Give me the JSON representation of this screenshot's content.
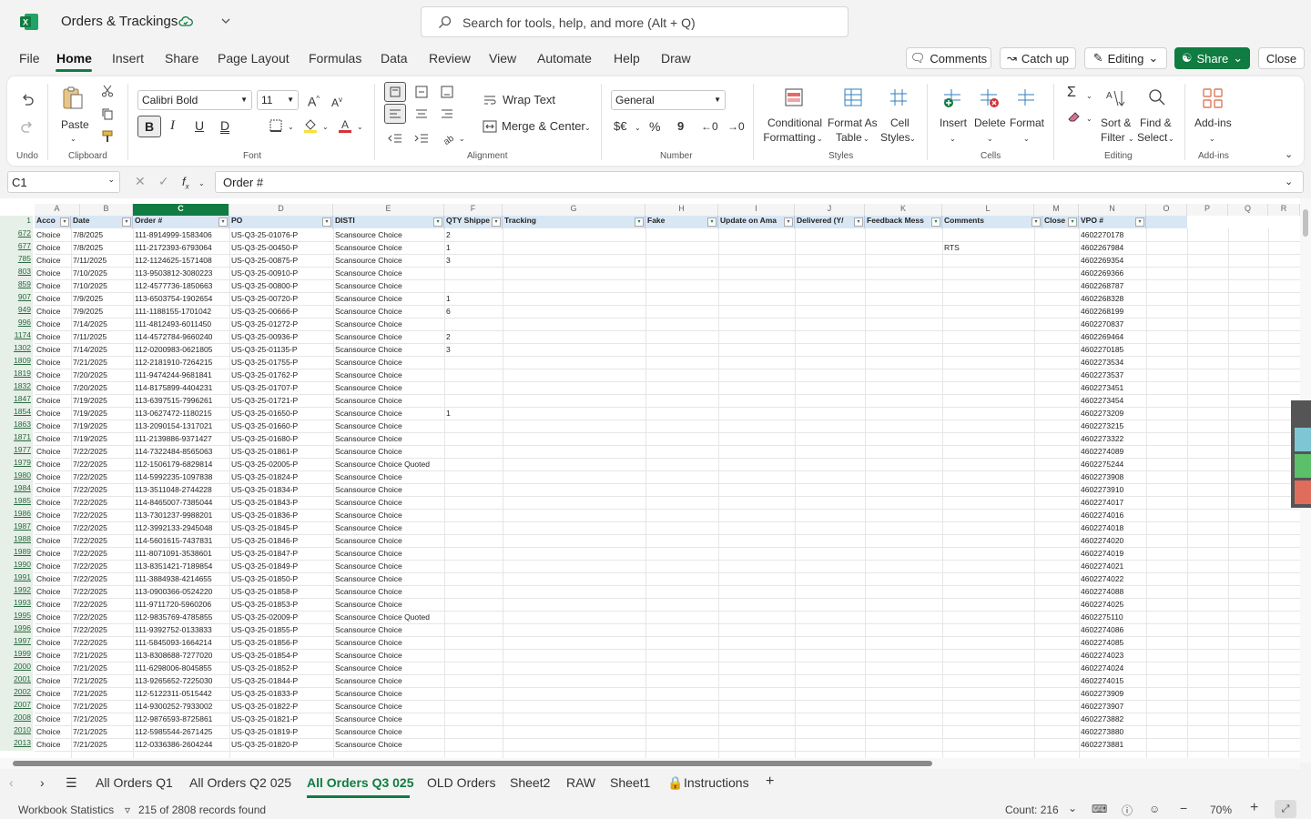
{
  "titlebar": {
    "doc_title": "Orders & Trackings",
    "search_placeholder": "Search for tools, help, and more (Alt + Q)"
  },
  "menu": [
    "File",
    "Home",
    "Insert",
    "Share",
    "Page Layout",
    "Formulas",
    "Data",
    "Review",
    "View",
    "Automate",
    "Help",
    "Draw"
  ],
  "top_buttons": {
    "comments": "Comments",
    "catch_up": "Catch up",
    "editing": "Editing",
    "share": "Share",
    "close": "Close"
  },
  "ribbon": {
    "undo": {
      "label": "Undo"
    },
    "clipboard": {
      "paste": "Paste",
      "label": "Clipboard"
    },
    "font": {
      "name": "Calibri Bold",
      "size": "11",
      "label": "Font"
    },
    "alignment": {
      "wrap": "Wrap Text",
      "merge": "Merge & Center",
      "label": "Alignment"
    },
    "number": {
      "format": "General",
      "label": "Number"
    },
    "styles": {
      "cond_a": "Conditional",
      "cond_b": "Formatting",
      "fat_a": "Format As",
      "fat_b": "Table",
      "cs_a": "Cell",
      "cs_b": "Styles",
      "label": "Styles"
    },
    "cells": {
      "insert": "Insert",
      "delete": "Delete",
      "format": "Format",
      "label": "Cells"
    },
    "editing": {
      "sort_a": "Sort &",
      "sort_b": "Filter",
      "find_a": "Find &",
      "find_b": "Select",
      "label": "Editing"
    },
    "addins": {
      "addins": "Add-ins",
      "label": "Add-ins"
    }
  },
  "formula": {
    "namebox": "C1",
    "content": "Order #"
  },
  "columns": [
    "A",
    "B",
    "C",
    "D",
    "E",
    "F",
    "G",
    "H",
    "I",
    "J",
    "K",
    "L",
    "M",
    "N",
    "O",
    "P",
    "Q",
    "R"
  ],
  "headers": [
    "Acco",
    "Date",
    "Order #",
    "PO",
    "DISTI",
    "QTY Shippe",
    "Tracking",
    "Fake",
    "Update on Ama",
    "Delivered (Y/",
    "Feedback Mess",
    "Comments",
    "Close",
    "VPO #"
  ],
  "rows": [
    [
      "672",
      "Choice",
      "7/8/2025",
      "111-8914999-1583406",
      "US-Q3-25-01076-P",
      "Scansource Choice",
      "2",
      "",
      "4602270178"
    ],
    [
      "677",
      "Choice",
      "7/8/2025",
      "111-2172393-6793064",
      "US-Q3-25-00450-P",
      "Scansource Choice",
      "1",
      "RTS",
      "4602267984"
    ],
    [
      "785",
      "Choice",
      "7/11/2025",
      "112-1124625-1571408",
      "US-Q3-25-00875-P",
      "Scansource Choice",
      "3",
      "",
      "4602269354"
    ],
    [
      "803",
      "Choice",
      "7/10/2025",
      "113-9503812-3080223",
      "US-Q3-25-00910-P",
      "Scansource Choice",
      "",
      "",
      "4602269366"
    ],
    [
      "859",
      "Choice",
      "7/10/2025",
      "112-4577736-1850663",
      "US-Q3-25-00800-P",
      "Scansource Choice",
      "",
      "",
      "4602268787"
    ],
    [
      "907",
      "Choice",
      "7/9/2025",
      "113-6503754-1902654",
      "US-Q3-25-00720-P",
      "Scansource Choice",
      "1",
      "",
      "4602268328"
    ],
    [
      "949",
      "Choice",
      "7/9/2025",
      "111-1188155-1701042",
      "US-Q3-25-00666-P",
      "Scansource Choice",
      "6",
      "",
      "4602268199"
    ],
    [
      "996",
      "Choice",
      "7/14/2025",
      "111-4812493-6011450",
      "US-Q3-25-01272-P",
      "Scansource Choice",
      "",
      "",
      "4602270837"
    ],
    [
      "1174",
      "Choice",
      "7/11/2025",
      "114-4572784-9660240",
      "US-Q3-25-00936-P",
      "Scansource Choice",
      "2",
      "",
      "4602269464"
    ],
    [
      "1302",
      "Choice",
      "7/14/2025",
      "112-0200983-0621805",
      "US-Q3-25-01135-P",
      "Scansource Choice",
      "3",
      "",
      "4602270185"
    ],
    [
      "1809",
      "Choice",
      "7/21/2025",
      "112-2181910-7264215",
      "US-Q3-25-01755-P",
      "Scansource Choice",
      "",
      "",
      "4602273534"
    ],
    [
      "1819",
      "Choice",
      "7/20/2025",
      "111-9474244-9681841",
      "US-Q3-25-01762-P",
      "Scansource Choice",
      "",
      "",
      "4602273537"
    ],
    [
      "1832",
      "Choice",
      "7/20/2025",
      "114-8175899-4404231",
      "US-Q3-25-01707-P",
      "Scansource Choice",
      "",
      "",
      "4602273451"
    ],
    [
      "1847",
      "Choice",
      "7/19/2025",
      "113-6397515-7996261",
      "US-Q3-25-01721-P",
      "Scansource Choice",
      "",
      "",
      "4602273454"
    ],
    [
      "1854",
      "Choice",
      "7/19/2025",
      "113-0627472-1180215",
      "US-Q3-25-01650-P",
      "Scansource Choice",
      "1",
      "",
      "4602273209"
    ],
    [
      "1863",
      "Choice",
      "7/19/2025",
      "113-2090154-1317021",
      "US-Q3-25-01660-P",
      "Scansource Choice",
      "",
      "",
      "4602273215"
    ],
    [
      "1871",
      "Choice",
      "7/19/2025",
      "111-2139886-9371427",
      "US-Q3-25-01680-P",
      "Scansource Choice",
      "",
      "",
      "4602273322"
    ],
    [
      "1977",
      "Choice",
      "7/22/2025",
      "114-7322484-8565063",
      "US-Q3-25-01861-P",
      "Scansource Choice",
      "",
      "",
      "4602274089"
    ],
    [
      "1979",
      "Choice",
      "7/22/2025",
      "112-1506179-6829814",
      "US-Q3-25-02005-P",
      "Scansource Choice Quoted",
      "",
      "",
      "4602275244"
    ],
    [
      "1980",
      "Choice",
      "7/22/2025",
      "114-5992235-1097838",
      "US-Q3-25-01824-P",
      "Scansource Choice",
      "",
      "",
      "4602273908"
    ],
    [
      "1984",
      "Choice",
      "7/22/2025",
      "113-3511048-2744228",
      "US-Q3-25-01834-P",
      "Scansource Choice",
      "",
      "",
      "4602273910"
    ],
    [
      "1985",
      "Choice",
      "7/22/2025",
      "114-8465007-7385044",
      "US-Q3-25-01843-P",
      "Scansource Choice",
      "",
      "",
      "4602274017"
    ],
    [
      "1986",
      "Choice",
      "7/22/2025",
      "113-7301237-9988201",
      "US-Q3-25-01836-P",
      "Scansource Choice",
      "",
      "",
      "4602274016"
    ],
    [
      "1987",
      "Choice",
      "7/22/2025",
      "112-3992133-2945048",
      "US-Q3-25-01845-P",
      "Scansource Choice",
      "",
      "",
      "4602274018"
    ],
    [
      "1988",
      "Choice",
      "7/22/2025",
      "114-5601615-7437831",
      "US-Q3-25-01846-P",
      "Scansource Choice",
      "",
      "",
      "4602274020"
    ],
    [
      "1989",
      "Choice",
      "7/22/2025",
      "111-8071091-3538601",
      "US-Q3-25-01847-P",
      "Scansource Choice",
      "",
      "",
      "4602274019"
    ],
    [
      "1990",
      "Choice",
      "7/22/2025",
      "113-8351421-7189854",
      "US-Q3-25-01849-P",
      "Scansource Choice",
      "",
      "",
      "4602274021"
    ],
    [
      "1991",
      "Choice",
      "7/22/2025",
      "111-3884938-4214655",
      "US-Q3-25-01850-P",
      "Scansource Choice",
      "",
      "",
      "4602274022"
    ],
    [
      "1992",
      "Choice",
      "7/22/2025",
      "113-0900366-0524220",
      "US-Q3-25-01858-P",
      "Scansource Choice",
      "",
      "",
      "4602274088"
    ],
    [
      "1993",
      "Choice",
      "7/22/2025",
      "111-9711720-5960206",
      "US-Q3-25-01853-P",
      "Scansource Choice",
      "",
      "",
      "4602274025"
    ],
    [
      "1995",
      "Choice",
      "7/22/2025",
      "112-9835769-4785855",
      "US-Q3-25-02009-P",
      "Scansource Choice Quoted",
      "",
      "",
      "4602275110"
    ],
    [
      "1996",
      "Choice",
      "7/22/2025",
      "111-9392752-0133833",
      "US-Q3-25-01855-P",
      "Scansource Choice",
      "",
      "",
      "4602274086"
    ],
    [
      "1997",
      "Choice",
      "7/22/2025",
      "111-5845093-1664214",
      "US-Q3-25-01856-P",
      "Scansource Choice",
      "",
      "",
      "4602274085"
    ],
    [
      "1999",
      "Choice",
      "7/21/2025",
      "113-8308688-7277020",
      "US-Q3-25-01854-P",
      "Scansource Choice",
      "",
      "",
      "4602274023"
    ],
    [
      "2000",
      "Choice",
      "7/21/2025",
      "111-6298006-8045855",
      "US-Q3-25-01852-P",
      "Scansource Choice",
      "",
      "",
      "4602274024"
    ],
    [
      "2001",
      "Choice",
      "7/21/2025",
      "113-9265652-7225030",
      "US-Q3-25-01844-P",
      "Scansource Choice",
      "",
      "",
      "4602274015"
    ],
    [
      "2002",
      "Choice",
      "7/21/2025",
      "112-5122311-0515442",
      "US-Q3-25-01833-P",
      "Scansource Choice",
      "",
      "",
      "4602273909"
    ],
    [
      "2007",
      "Choice",
      "7/21/2025",
      "114-9300252-7933002",
      "US-Q3-25-01822-P",
      "Scansource Choice",
      "",
      "",
      "4602273907"
    ],
    [
      "2008",
      "Choice",
      "7/21/2025",
      "112-9876593-8725861",
      "US-Q3-25-01821-P",
      "Scansource Choice",
      "",
      "",
      "4602273882"
    ],
    [
      "2010",
      "Choice",
      "7/21/2025",
      "112-5985544-2671425",
      "US-Q3-25-01819-P",
      "Scansource Choice",
      "",
      "",
      "4602273880"
    ],
    [
      "2013",
      "Choice",
      "7/21/2025",
      "112-0336386-2604244",
      "US-Q3-25-01820-P",
      "Scansource Choice",
      "",
      "",
      "4602273881"
    ]
  ],
  "sheets": [
    "All Orders Q1",
    "All Orders Q2 025",
    "All Orders Q3 025",
    "OLD Orders",
    "Sheet2",
    "RAW",
    "Sheet1",
    "Instructions"
  ],
  "status": {
    "workbook": "Workbook Statistics",
    "records": "215 of 2808 records found",
    "count": "Count: 216",
    "zoom": "70%"
  },
  "accent": "#107c41"
}
